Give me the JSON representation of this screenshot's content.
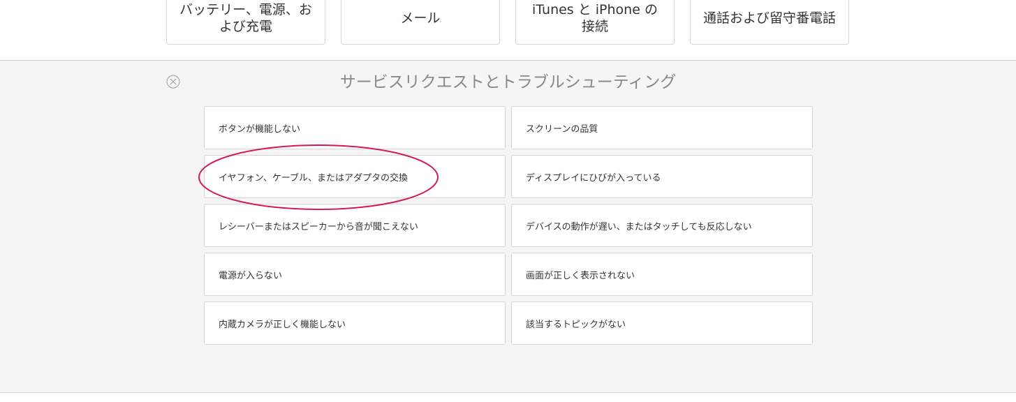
{
  "top_cards": [
    {
      "label": "バッテリー、電源、および充電"
    },
    {
      "label": "メール"
    },
    {
      "label": "iTunes と iPhone の接続"
    },
    {
      "label": "通話および留守番電話"
    }
  ],
  "panel": {
    "title": "サービスリクエストとトラブルシューティング",
    "close_icon": "close-circle-icon",
    "topics_left": [
      {
        "label": "ボタンが機能しない"
      },
      {
        "label": "イヤフォン、ケーブル、またはアダプタの交換"
      },
      {
        "label": "レシーバーまたはスピーカーから音が聞こえない"
      },
      {
        "label": "電源が入らない"
      },
      {
        "label": "内蔵カメラが正しく機能しない"
      }
    ],
    "topics_right": [
      {
        "label": "スクリーンの品質"
      },
      {
        "label": "ディスプレイにひびが入っている"
      },
      {
        "label": "デバイスの動作が遅い、またはタッチしても反応しない"
      },
      {
        "label": "画面が正しく表示されない"
      },
      {
        "label": "該当するトピックがない"
      }
    ]
  },
  "colors": {
    "highlight_ellipse": "#d6185a",
    "panel_background": "#f5f5f5",
    "border": "#d6d6d6"
  }
}
